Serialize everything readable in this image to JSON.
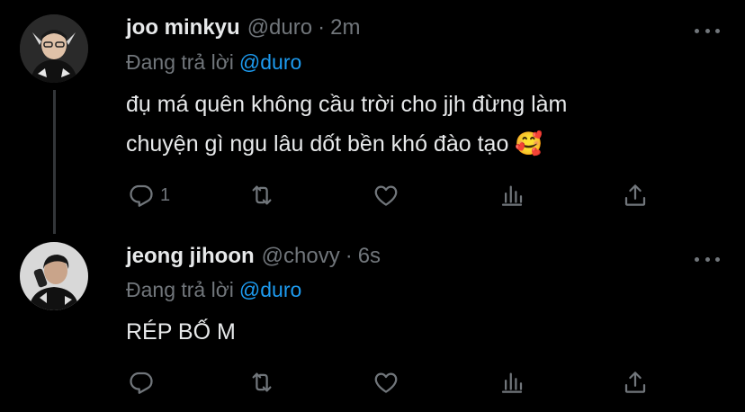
{
  "colors": {
    "background": "#000000",
    "primary_text": "#e7e9ea",
    "secondary_text": "#71767b",
    "accent": "#1d9bf0",
    "thread_line": "#333639"
  },
  "tweets": [
    {
      "author_name": "joo minkyu",
      "handle": "@duro",
      "separator": "·",
      "time": "2m",
      "reply_prefix": "Đang trả lời",
      "reply_to": "@duro",
      "body_lines": [
        "đụ má quên không cầu trời cho jjh đừng làm",
        "chuyện gì ngu lâu dốt bền khó đào tạo 🥰"
      ],
      "reply_count": "1",
      "retweet_count": "",
      "like_count": "",
      "icons": [
        "reply-icon",
        "retweet-icon",
        "like-icon",
        "views-icon",
        "share-icon"
      ]
    },
    {
      "author_name": "jeong jihoon",
      "handle": "@chovy",
      "separator": "·",
      "time": "6s",
      "reply_prefix": "Đang trả lời",
      "reply_to": "@duro",
      "body_lines": [
        "RÉP BỐ M"
      ],
      "reply_count": "",
      "retweet_count": "",
      "like_count": "",
      "icons": [
        "reply-icon",
        "retweet-icon",
        "like-icon",
        "views-icon",
        "share-icon"
      ]
    }
  ]
}
